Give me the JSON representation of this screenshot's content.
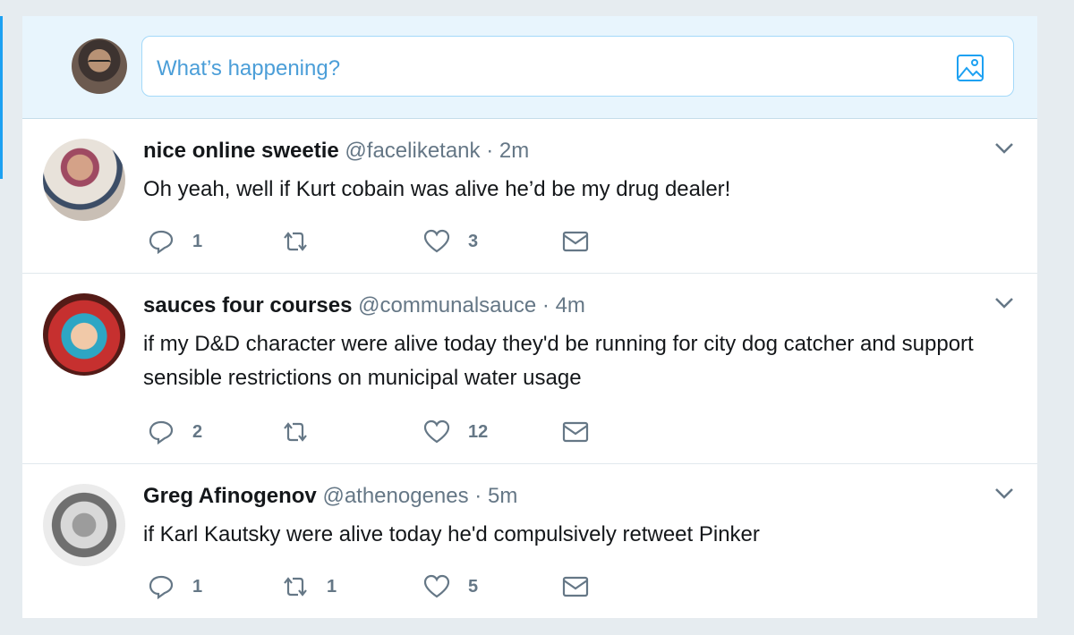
{
  "composer": {
    "placeholder": "What’s happening?",
    "avatar_icon": "user-avatar",
    "media_icon": "image-icon"
  },
  "tweets": [
    {
      "name": "nice online sweetie",
      "handle": "@faceliketank",
      "dot": "·",
      "time": "2m",
      "text": "Oh yeah, well if Kurt cobain was alive he’d be my drug dealer!",
      "replies": "1",
      "retweets": "",
      "likes": "3"
    },
    {
      "name": "sauces four courses",
      "handle": "@communalsauce",
      "dot": "·",
      "time": "4m",
      "text": "if my D&D character were alive today they'd be running for city dog catcher and support sensible restrictions on municipal water usage",
      "replies": "2",
      "retweets": "",
      "likes": "12"
    },
    {
      "name": "Greg Afinogenov",
      "handle": "@athenogenes",
      "dot": "·",
      "time": "5m",
      "text": "if Karl Kautsky were alive today he'd compulsively retweet Pinker",
      "replies": "1",
      "retweets": "1",
      "likes": "5"
    }
  ],
  "colors": {
    "accent": "#1da1f2",
    "muted": "#657786",
    "text": "#14171a",
    "composer_bg": "#e8f5fd"
  }
}
